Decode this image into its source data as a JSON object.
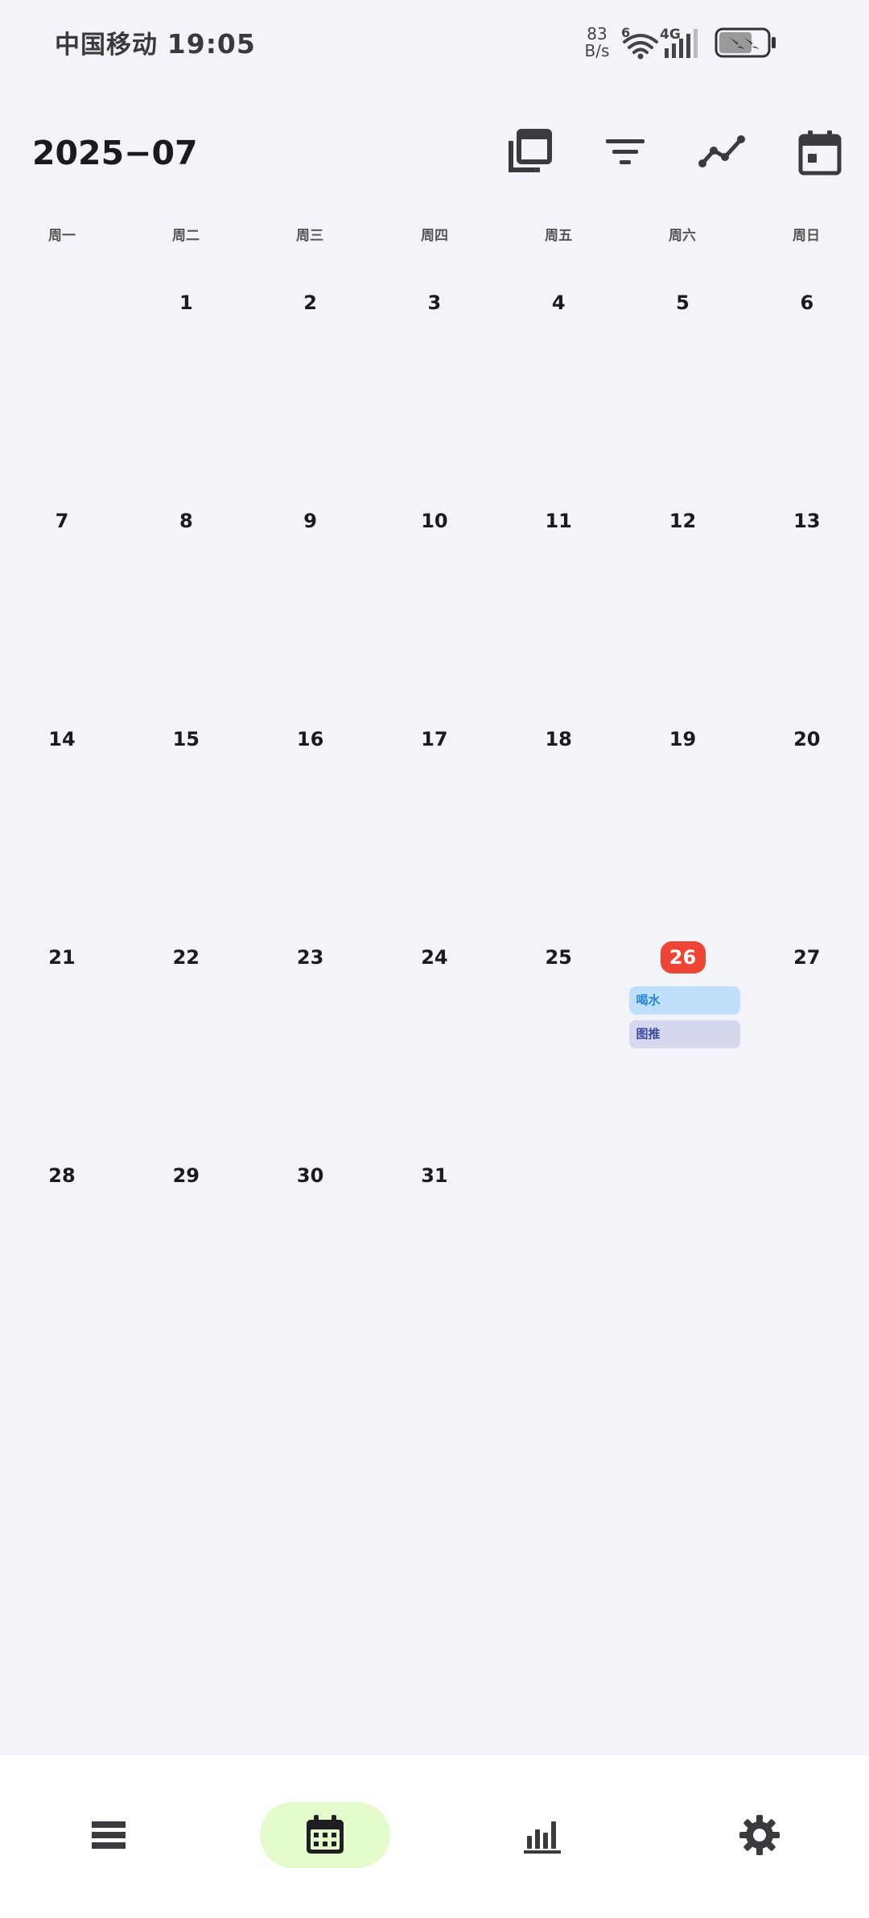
{
  "status_bar": {
    "carrier": "中国移动",
    "time": "19:05",
    "net_speed_value": "83",
    "net_speed_unit": "B/s",
    "wifi_badge": "6",
    "network_type": "4G"
  },
  "header": {
    "month_title": "2025−07",
    "icons": [
      "copy-icon",
      "filter-icon",
      "trend-line-icon",
      "calendar-icon"
    ]
  },
  "weekdays": [
    "周一",
    "周二",
    "周三",
    "周四",
    "周五",
    "周六",
    "周日"
  ],
  "calendar": {
    "first_weekday_offset": 1,
    "days_in_month": 31,
    "today": 26,
    "events": [
      {
        "day": 26,
        "label": "喝水",
        "color": "#bfe0fb",
        "text_color": "#2b86d8"
      },
      {
        "day": 26,
        "label": "图推",
        "color": "#d5d8ee",
        "text_color": "#3d4c9c"
      }
    ]
  },
  "bottom_nav": {
    "items": [
      {
        "name": "list",
        "icon": "list-icon",
        "active": false
      },
      {
        "name": "calendar",
        "icon": "calendar-grid-icon",
        "active": true
      },
      {
        "name": "stats",
        "icon": "bar-chart-icon",
        "active": false
      },
      {
        "name": "settings",
        "icon": "gear-icon",
        "active": false
      }
    ]
  },
  "colors": {
    "background": "#f3f4f9",
    "today_badge": "#ee4433",
    "nav_active_pill": "#e4fccc",
    "icon": "#3b3b3f"
  }
}
